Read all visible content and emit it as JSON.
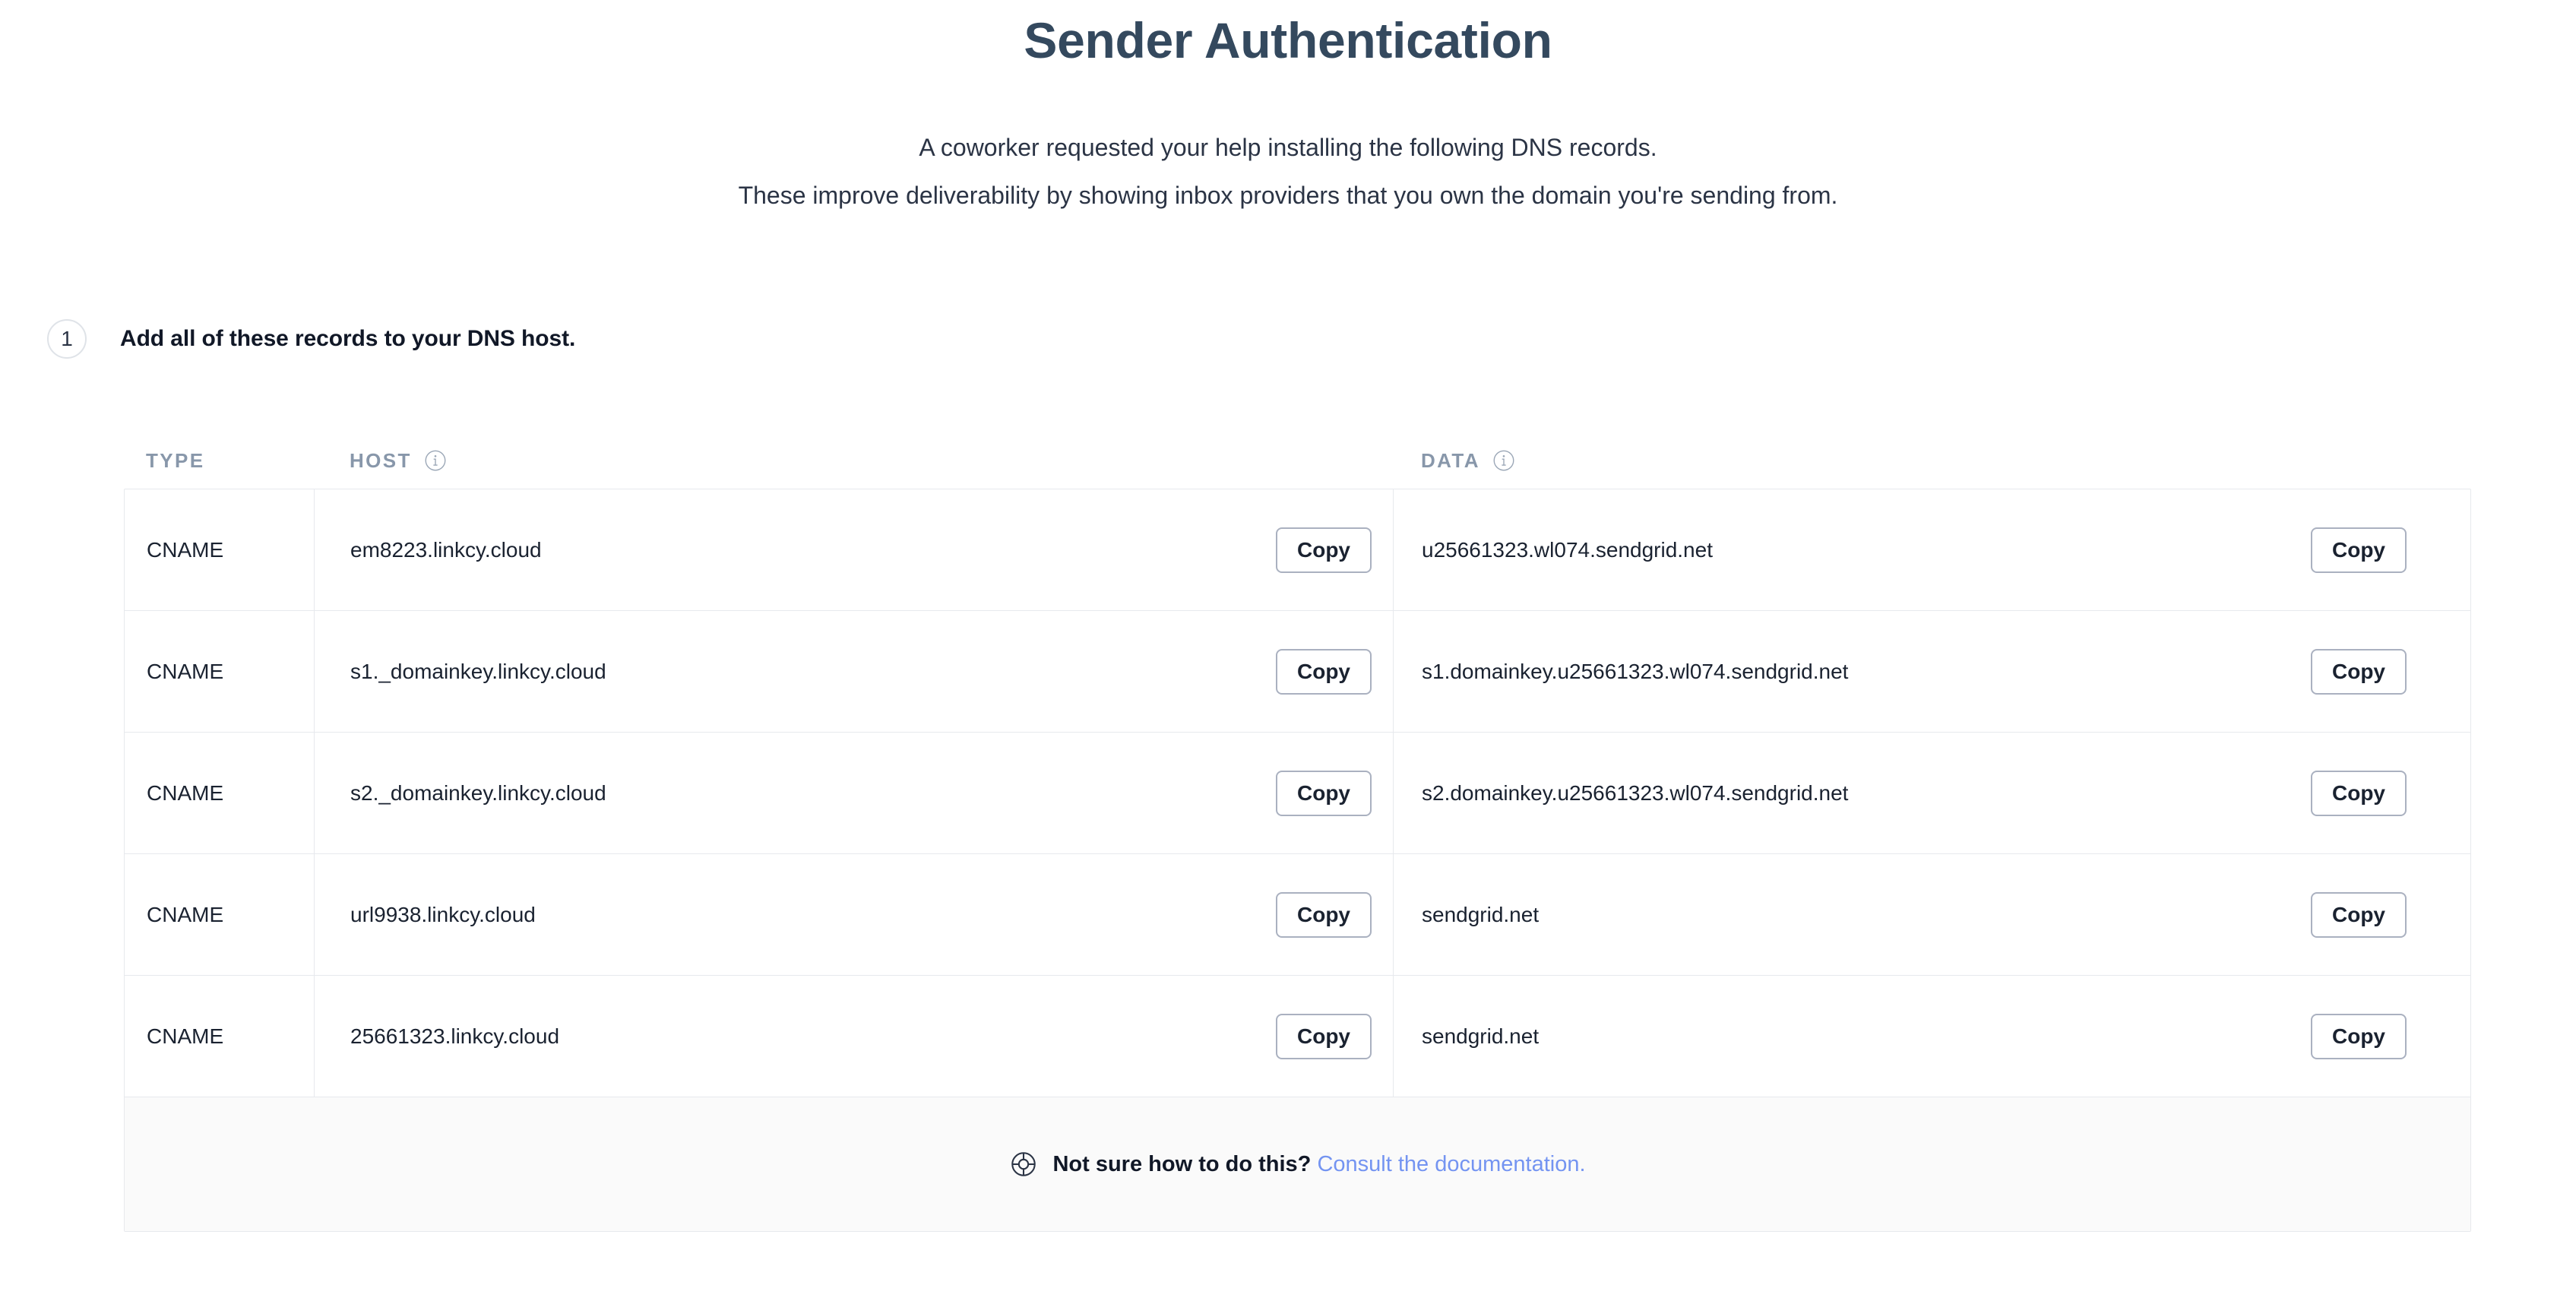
{
  "header": {
    "title": "Sender Authentication",
    "intro_line_1": "A coworker requested your help installing the following DNS records.",
    "intro_line_2": "These improve deliverability by showing inbox providers that you own the domain you're sending from."
  },
  "step": {
    "number": "1",
    "title": "Add all of these records to your DNS host."
  },
  "table": {
    "columns": {
      "type": "TYPE",
      "host": "HOST",
      "data": "DATA",
      "host_info_icon": "info-icon",
      "data_info_icon": "info-icon"
    },
    "copy_label": "Copy",
    "rows": [
      {
        "type": "CNAME",
        "host": "em8223.linkcy.cloud",
        "data": "u25661323.wl074.sendgrid.net"
      },
      {
        "type": "CNAME",
        "host": "s1._domainkey.linkcy.cloud",
        "data": "s1.domainkey.u25661323.wl074.sendgrid.net"
      },
      {
        "type": "CNAME",
        "host": "s2._domainkey.linkcy.cloud",
        "data": "s2.domainkey.u25661323.wl074.sendgrid.net"
      },
      {
        "type": "CNAME",
        "host": "url9938.linkcy.cloud",
        "data": "sendgrid.net"
      },
      {
        "type": "CNAME",
        "host": "25661323.linkcy.cloud",
        "data": "sendgrid.net"
      }
    ]
  },
  "footer": {
    "icon": "lifebuoy-icon",
    "question": "Not sure how to do this? ",
    "link_text": "Consult the documentation",
    "link_suffix": "."
  },
  "colors": {
    "title": "#34495e",
    "body_text": "#2b3445",
    "column_header": "#8897aa",
    "border": "#e7e9ed",
    "button_border": "#aab1c0",
    "link": "#7494f1",
    "footer_bg": "#fafafa"
  }
}
